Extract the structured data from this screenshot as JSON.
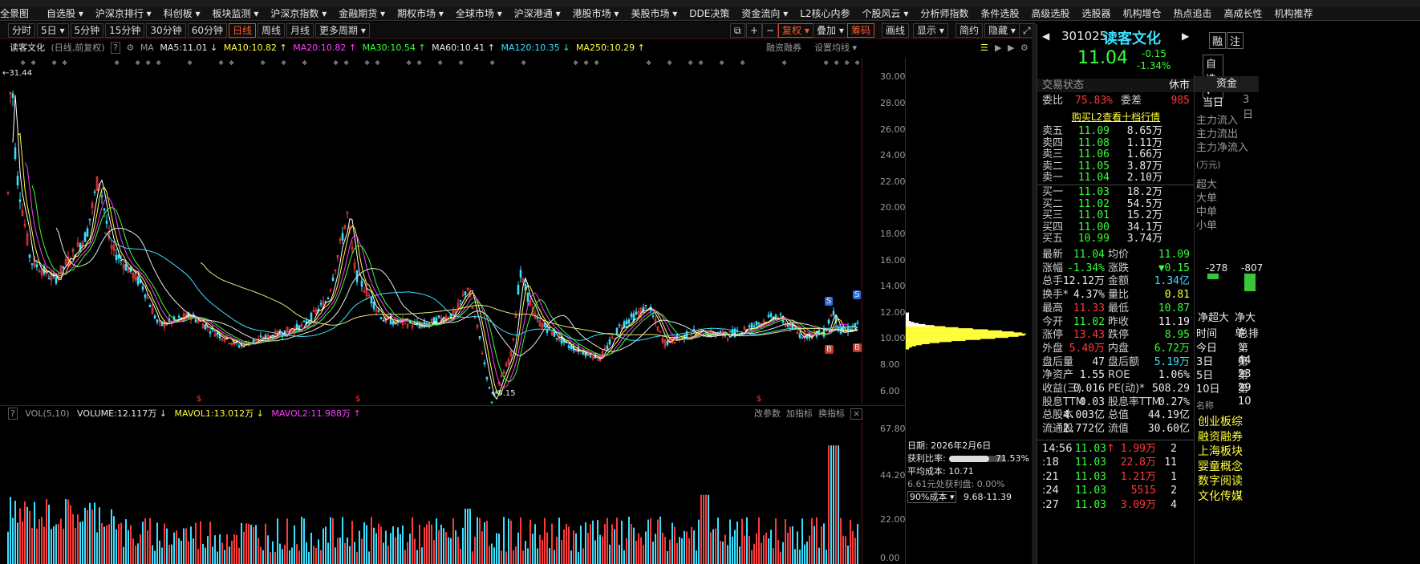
{
  "menu": [
    "全景图",
    "自选股 ▾",
    "沪深京排行 ▾",
    "科创板 ▾",
    "板块监测 ▾",
    "沪深京指数 ▾",
    "金融期货 ▾",
    "期权市场 ▾",
    "全球市场 ▾",
    "沪深港通 ▾",
    "港股市场 ▾",
    "美股市场 ▾",
    "DDE决策",
    "资金流向 ▾",
    "L2核心内参",
    "个股风云 ▾",
    "分析师指数",
    "条件选股",
    "高级选股",
    "选股器",
    "机构增仓",
    "热点追击",
    "高成长性",
    "机构推荐"
  ],
  "toolbar": {
    "periods": [
      "分时",
      "5日 ▾",
      "5分钟",
      "15分钟",
      "30分钟",
      "60分钟",
      "日线",
      "周线",
      "月线",
      "更多周期 ▾"
    ],
    "active_period": "日线",
    "right": {
      "fq": "复权 ▾",
      "overlay": "叠加 ▾",
      "chips": "筹码",
      "draw": "画线",
      "display": "显示 ▾",
      "simple": "简约",
      "hide": "隐藏 ▾"
    }
  },
  "ma_line": {
    "title": "读客文化",
    "subtitle": "(日线,前复权)",
    "help": "?",
    "ma_label": "MA",
    "ma5": "MA5:11.01 ↓",
    "ma10": "MA10:10.82 ↑",
    "ma20": "MA20:10.82 ↑",
    "ma30": "MA30:10.54 ↑",
    "ma60": "MA60:10.41 ↑",
    "ma120": "MA120:10.35 ↓",
    "ma250": "MA250:10.29 ↑",
    "margin": "融资融券",
    "set_ma": "设置均线 ▾"
  },
  "price_axis": [
    "30.00",
    "28.00",
    "26.00",
    "24.00",
    "22.00",
    "20.00",
    "18.00",
    "16.00",
    "14.00",
    "12.00",
    "10.00",
    "8.00",
    "6.00"
  ],
  "price_annotations": {
    "high": "←31.44",
    "low": "←5.15",
    "s": "S",
    "b": "B",
    "dollar": "$"
  },
  "volume": {
    "label": "VOL(5,10)",
    "volume": "VOLUME:12.117万 ↓",
    "mavol1": "MAVOL1:13.012万 ↓",
    "mavol2": "MAVOL2:11.988万 ↑",
    "actions": [
      "改参数",
      "加指标",
      "换指标"
    ],
    "axis": [
      "67.80",
      "44.20",
      "22.00",
      "0.00"
    ]
  },
  "chips": {
    "date": "日期: 2026年2月6日",
    "profit_ratio_label": "获利比率:",
    "profit_ratio": "71.53%",
    "avg_cost": "平均成本: 10.71",
    "profit_at": "6.61元处获利盘: 0.00%",
    "cost_select": "90%成本 ▾",
    "cost_range": "9.68-11.39"
  },
  "quote": {
    "code": "301025",
    "name": "读客文化",
    "price": "11.04",
    "change": "-0.15",
    "change_pct": "-1.34%",
    "buttons": [
      "融",
      "注"
    ],
    "watch_btn": "自选- ▾",
    "status_label": "交易状态",
    "status": "休市",
    "webi_label": "委比",
    "webi": "75.83%",
    "weicha_label": "委差",
    "weicha": "985",
    "l2_link": "购买L2查看十档行情",
    "sells": [
      {
        "label": "卖五",
        "price": "11.09",
        "vol": "8.65万"
      },
      {
        "label": "卖四",
        "price": "11.08",
        "vol": "1.11万"
      },
      {
        "label": "卖三",
        "price": "11.06",
        "vol": "1.66万"
      },
      {
        "label": "卖二",
        "price": "11.05",
        "vol": "3.87万"
      },
      {
        "label": "卖一",
        "price": "11.04",
        "vol": "2.10万"
      }
    ],
    "buys": [
      {
        "label": "买一",
        "price": "11.03",
        "vol": "18.2万"
      },
      {
        "label": "买二",
        "price": "11.02",
        "vol": "54.5万"
      },
      {
        "label": "买三",
        "price": "11.01",
        "vol": "15.2万"
      },
      {
        "label": "买四",
        "price": "11.00",
        "vol": "34.1万"
      },
      {
        "label": "买五",
        "price": "10.99",
        "vol": "3.74万"
      }
    ],
    "stats": [
      {
        "l1": "最新",
        "v1": "11.04",
        "c1": "green",
        "l2": "均价",
        "v2": "11.09",
        "c2": "green"
      },
      {
        "l1": "涨幅",
        "v1": "-1.34%",
        "c1": "green",
        "l2": "涨跌",
        "v2": "▼0.15",
        "c2": "green"
      },
      {
        "l1": "总手",
        "v1": "12.12万",
        "c1": "white",
        "l2": "金额",
        "v2": "1.34亿",
        "c2": "cyan"
      },
      {
        "l1": "换手*",
        "v1": "4.37%",
        "c1": "white",
        "l2": "量比",
        "v2": "0.81",
        "c2": "yel"
      },
      {
        "l1": "最高",
        "v1": "11.33",
        "c1": "red",
        "l2": "最低",
        "v2": "10.87",
        "c2": "green"
      },
      {
        "l1": "今开",
        "v1": "11.02",
        "c1": "green",
        "l2": "昨收",
        "v2": "11.19",
        "c2": "white"
      },
      {
        "l1": "涨停",
        "v1": "13.43",
        "c1": "red",
        "l2": "跌停",
        "v2": "8.95",
        "c2": "green"
      },
      {
        "l1": "外盘",
        "v1": "5.40万",
        "c1": "red",
        "l2": "内盘",
        "v2": "6.72万",
        "c2": "green"
      },
      {
        "l1": "盘后量",
        "v1": "47",
        "c1": "white",
        "l2": "盘后额",
        "v2": "5.19万",
        "c2": "cyan"
      },
      {
        "l1": "净资产",
        "v1": "1.55",
        "c1": "white",
        "l2": "ROE",
        "v2": "1.06%",
        "c2": "white"
      },
      {
        "l1": "收益(三)",
        "v1": "0.016",
        "c1": "white",
        "l2": "PE(动)*",
        "v2": "508.29",
        "c2": "white"
      },
      {
        "l1": "股息TTM",
        "v1": "0.03",
        "c1": "white",
        "l2": "股息率TTM",
        "v2": "0.27%",
        "c2": "white"
      },
      {
        "l1": "总股本",
        "v1": "4.003亿",
        "c1": "white",
        "l2": "总值",
        "v2": "44.19亿",
        "c2": "white"
      },
      {
        "l1": "流通股",
        "v1": "2.772亿",
        "c1": "white",
        "l2": "流值",
        "v2": "30.60亿",
        "c2": "white"
      }
    ],
    "ticks": [
      {
        "time": "14:56",
        "price": "11.03",
        "arrow": "↑",
        "vol": "1.99万",
        "n": "2"
      },
      {
        "time": ":18",
        "price": "11.03",
        "arrow": "",
        "vol": "22.8万",
        "n": "11"
      },
      {
        "time": ":21",
        "price": "11.03",
        "arrow": "",
        "vol": "1.21万",
        "n": "1"
      },
      {
        "time": ":24",
        "price": "11.03",
        "arrow": "",
        "vol": "5515",
        "n": "2"
      },
      {
        "time": ":27",
        "price": "11.03",
        "arrow": "",
        "vol": "3.09万",
        "n": "4"
      }
    ]
  },
  "fund": {
    "tab": "资金",
    "subtabs": [
      "当日",
      "3日"
    ],
    "flows": [
      "主力流入",
      "主力流出",
      "主力净流入"
    ],
    "unit": "(万元)",
    "sizes": [
      "超大",
      "大单",
      "中单",
      "小单"
    ],
    "bar_values": [
      "-278",
      "-807"
    ],
    "net_labels": [
      "净超大",
      "净大单"
    ],
    "time_header": [
      "时间",
      "总排"
    ],
    "time_rows": [
      [
        "今日",
        "第44"
      ],
      [
        "3日",
        "第23"
      ],
      [
        "5日",
        "第29"
      ],
      [
        "10日",
        "第10"
      ]
    ],
    "name_header": "名称",
    "sectors": [
      "创业板综",
      "融资融券",
      "上海板块",
      "婴童概念",
      "数字阅读",
      "文化传媒"
    ]
  }
}
